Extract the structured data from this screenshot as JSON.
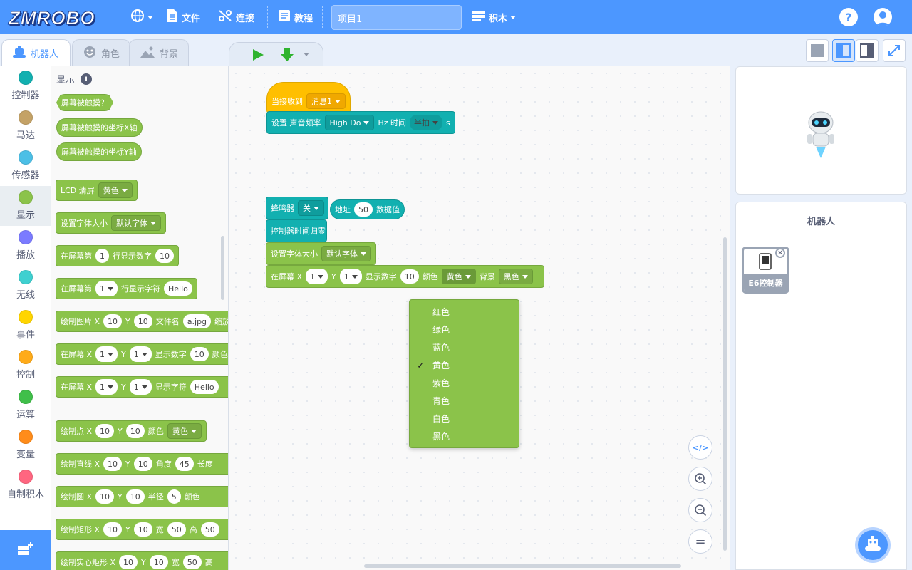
{
  "logo": "ZMROBO",
  "menu": {
    "file": "文件",
    "connect": "连接",
    "tutorial": "教程",
    "project_name": "项目1",
    "blocks": "积木"
  },
  "tabs": {
    "robot": "机器人",
    "sprite": "角色",
    "backdrop": "背景"
  },
  "categories": [
    {
      "label": "控制器",
      "color": "#12b0b0"
    },
    {
      "label": "马达",
      "color": "#c4a266"
    },
    {
      "label": "传感器",
      "color": "#4cbfe6"
    },
    {
      "label": "显示",
      "color": "#8bc34a"
    },
    {
      "label": "播放",
      "color": "#7b7bff"
    },
    {
      "label": "无线",
      "color": "#3fd0d0"
    },
    {
      "label": "事件",
      "color": "#ffd500"
    },
    {
      "label": "控制",
      "color": "#ffab19"
    },
    {
      "label": "运算",
      "color": "#40bf4a"
    },
    {
      "label": "变量",
      "color": "#ff8c1a"
    },
    {
      "label": "自制积木",
      "color": "#ff6680"
    }
  ],
  "palette": {
    "section": "显示",
    "b1": "屏幕被触摸？",
    "b2": "屏幕被触摸的坐标X轴",
    "b3": "屏幕被触摸的坐标Y轴",
    "lcd_clear": "LCD 清屏",
    "color_yellow": "黄色",
    "set_font": "设置字体大小",
    "default_font": "默认字体",
    "on_screen_row": "在屏幕第",
    "one": "1",
    "show_num_row": "行显示数字",
    "ten": "10",
    "show_str_row": "行显示字符",
    "hello": "Hello",
    "draw_img": "绘制图片 X",
    "y": "Y",
    "filename": "文件名",
    "jpg": "a.jpg",
    "scale": "缩放",
    "on_screen_x": "在屏幕 X",
    "show_num": "显示数字",
    "color": "颜色",
    "show_str": "显示字符",
    "draw_point": "绘制点 X",
    "draw_line": "绘制直线 X",
    "angle": "角度",
    "forty5": "45",
    "length": "长度",
    "draw_circle": "绘制圆 X",
    "radius": "半径",
    "five": "5",
    "draw_rect": "绘制矩形 X",
    "width": "宽",
    "fifty": "50",
    "height": "高",
    "draw_filled_rect": "绘制实心矩形 X"
  },
  "scripts": {
    "when_receive": "当接收到",
    "message": "消息1",
    "set_freq": "设置 声音频率",
    "high_do": "High Do",
    "hz_time": "Hz 时间",
    "half_beat": "半拍",
    "s": "s",
    "buzzer": "蜂鸣器",
    "off": "关",
    "address": "地址",
    "fifty": "50",
    "data_value": "数据值",
    "timer_reset": "控制器时间归零",
    "set_font": "设置字体大小",
    "default_font": "默认字体",
    "on_screen_x": "在屏幕 X",
    "one": "1",
    "y": "Y",
    "show_num": "显示数字",
    "ten": "10",
    "color": "颜色",
    "yellow": "黄色",
    "bg": "背景",
    "black": "黑色"
  },
  "dropdown": {
    "items": [
      "红色",
      "绿色",
      "蓝色",
      "黄色",
      "紫色",
      "青色",
      "白色",
      "黑色"
    ],
    "selected_index": 3,
    "check": "✓"
  },
  "zoom": {
    "code": "</>",
    "equal": "="
  },
  "sprite_panel": {
    "title": "机器人",
    "device": "E6控制器"
  }
}
